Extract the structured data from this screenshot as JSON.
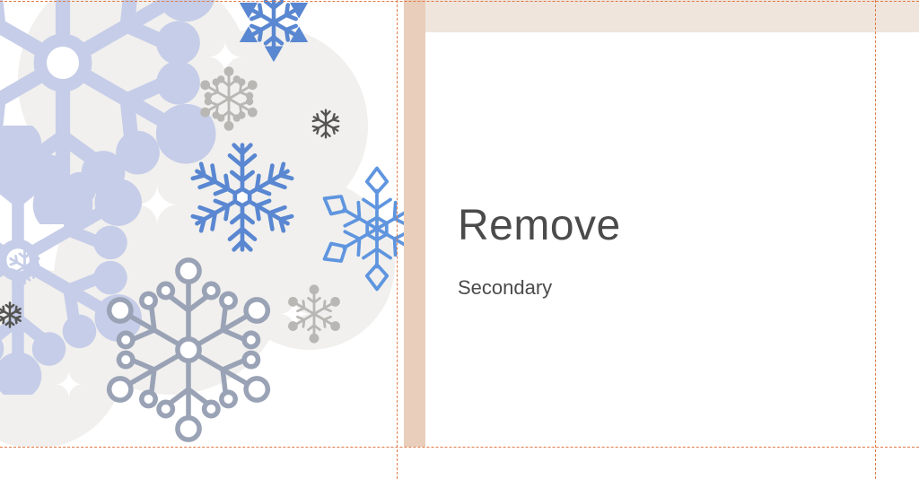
{
  "slide": {
    "title": "Remove",
    "subtitle": "Secondary"
  },
  "illustration": {
    "description": "snowflakes-winter",
    "palette": {
      "lavender": "#c6cde8",
      "blue_outline": "#6c92d2",
      "blue_solid": "#5a87d1",
      "blue_bright": "#5f95df",
      "grey": "#b8b7b3",
      "dark_grey": "#545452",
      "steel": "#9aa3b6",
      "cloud": "#f1f0ee"
    }
  }
}
